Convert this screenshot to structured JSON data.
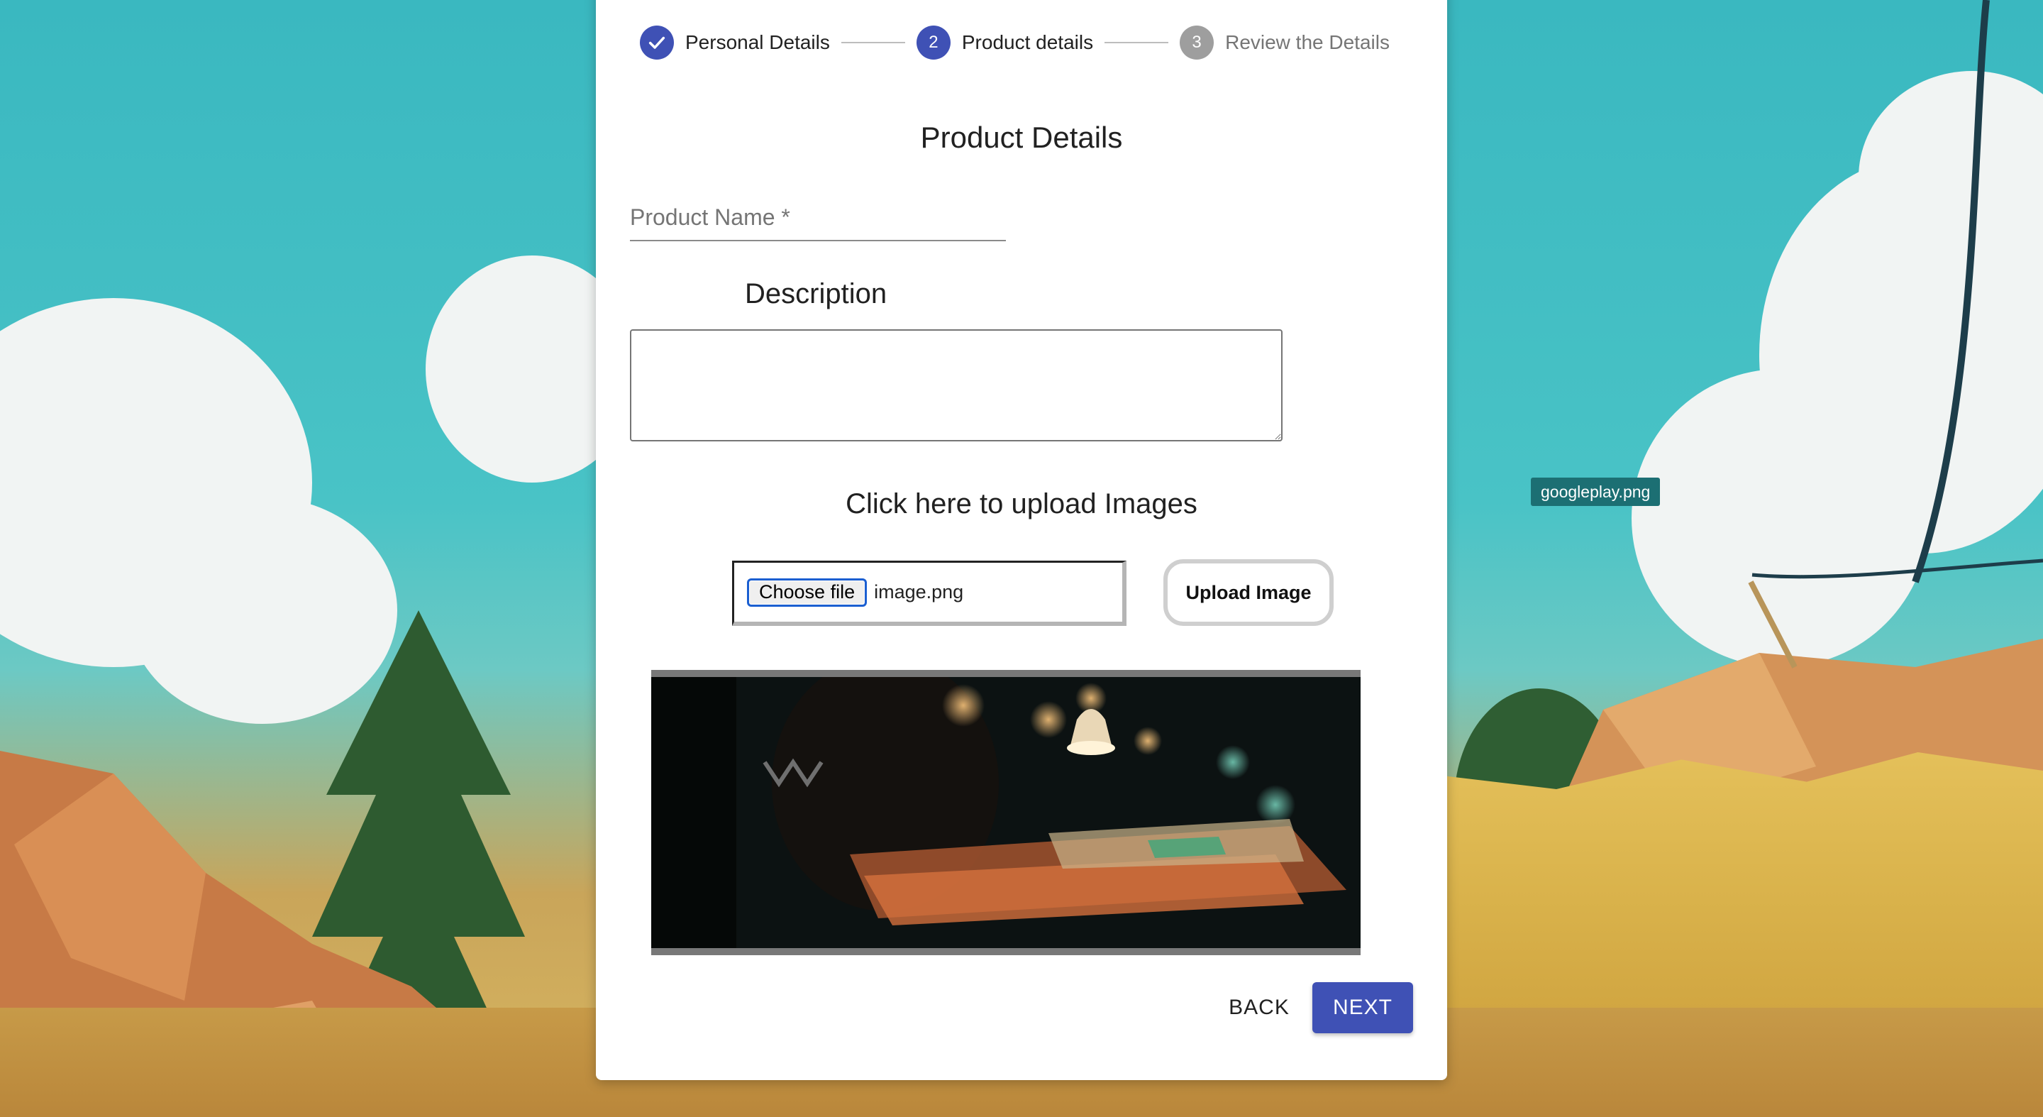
{
  "desktop": {
    "file_label": "googleplay.png"
  },
  "stepper": {
    "steps": [
      {
        "label": "Personal Details",
        "status": "completed",
        "icon": "check-icon"
      },
      {
        "label": "Product details",
        "status": "active",
        "number": "2"
      },
      {
        "label": "Review the Details",
        "status": "pending",
        "number": "3"
      }
    ]
  },
  "form": {
    "section_title": "Product Details",
    "product_name": {
      "label": "Product Name",
      "required_marker": " *",
      "value": ""
    },
    "description": {
      "label": "Description",
      "value": ""
    },
    "upload": {
      "heading": "Click here to upload Images",
      "choose_file_label": "Choose file",
      "file_name": "image.png",
      "upload_button_label": "Upload Image"
    }
  },
  "actions": {
    "back_label": "BACK",
    "next_label": "NEXT"
  },
  "colors": {
    "primary": "#3f51b5",
    "pending": "#9e9e9e"
  }
}
